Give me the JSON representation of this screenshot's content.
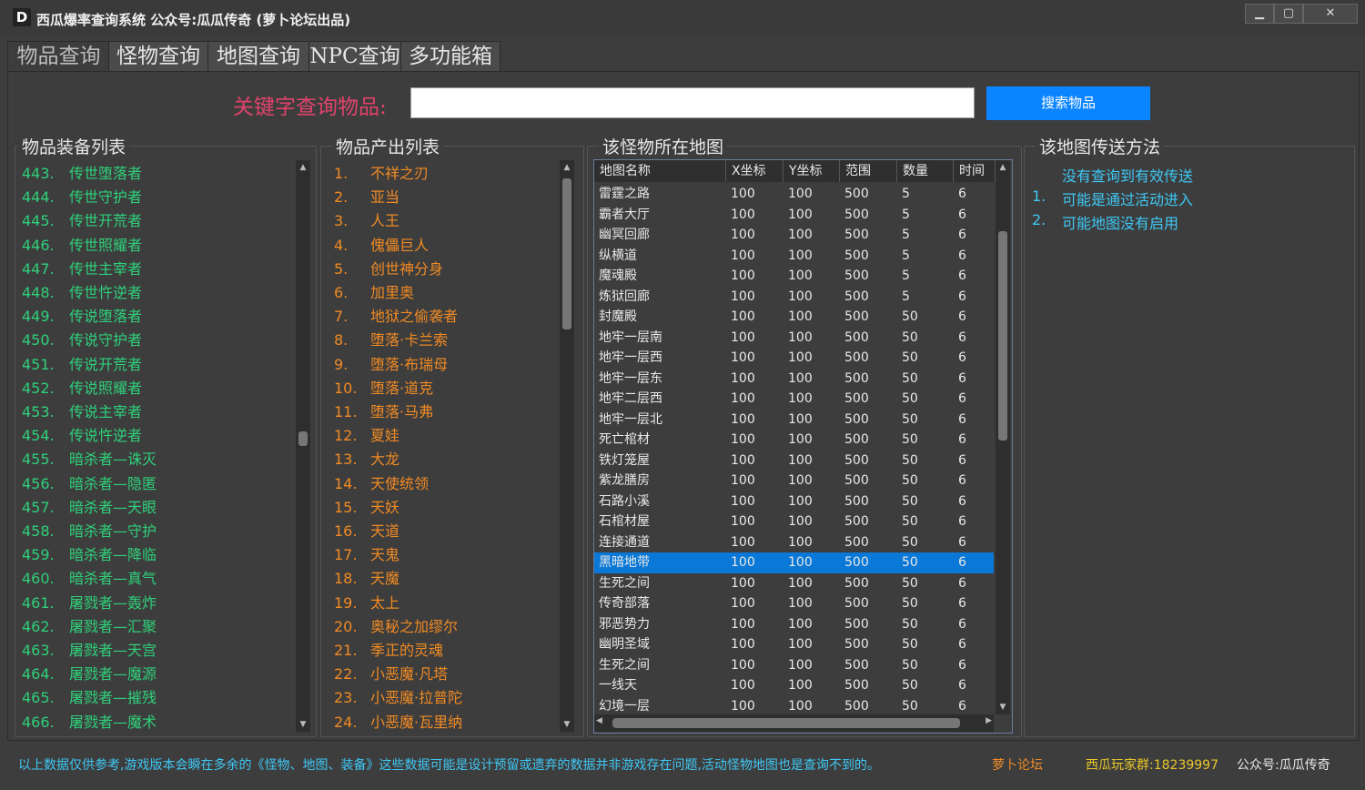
{
  "window": {
    "icon_letter": "D",
    "title": "西瓜爆率查询系统  公众号:瓜瓜传奇  (萝卜论坛出品)",
    "min_label": "▁",
    "max_label": "▢",
    "close_label": "✕"
  },
  "tabs": [
    {
      "label": "物品查询",
      "active": true
    },
    {
      "label": "怪物查询",
      "active": false
    },
    {
      "label": "地图查询",
      "active": false
    },
    {
      "label": "NPC查询",
      "active": false
    },
    {
      "label": "多功能箱",
      "active": false
    }
  ],
  "search": {
    "label": "关键字查询物品:",
    "value": "",
    "button_label": "搜索物品"
  },
  "items_panel": {
    "title": "物品装备列表",
    "color": "#2fd07a",
    "rows": [
      {
        "num": "443.",
        "name": "传世堕落者"
      },
      {
        "num": "444.",
        "name": "传世守护者"
      },
      {
        "num": "445.",
        "name": "传世开荒者"
      },
      {
        "num": "446.",
        "name": "传世照耀者"
      },
      {
        "num": "447.",
        "name": "传世主宰者"
      },
      {
        "num": "448.",
        "name": "传世忤逆者"
      },
      {
        "num": "449.",
        "name": "传说堕落者"
      },
      {
        "num": "450.",
        "name": "传说守护者"
      },
      {
        "num": "451.",
        "name": "传说开荒者"
      },
      {
        "num": "452.",
        "name": "传说照耀者"
      },
      {
        "num": "453.",
        "name": "传说主宰者"
      },
      {
        "num": "454.",
        "name": "传说忤逆者"
      },
      {
        "num": "455.",
        "name": "暗杀者—诛灭"
      },
      {
        "num": "456.",
        "name": "暗杀者—隐匿"
      },
      {
        "num": "457.",
        "name": "暗杀者—天眼"
      },
      {
        "num": "458.",
        "name": "暗杀者—守护"
      },
      {
        "num": "459.",
        "name": "暗杀者—降临"
      },
      {
        "num": "460.",
        "name": "暗杀者—真气"
      },
      {
        "num": "461.",
        "name": "屠戮者—轰炸"
      },
      {
        "num": "462.",
        "name": "屠戮者—汇聚"
      },
      {
        "num": "463.",
        "name": "屠戮者—天宫"
      },
      {
        "num": "464.",
        "name": "屠戮者—魔源"
      },
      {
        "num": "465.",
        "name": "屠戮者—摧残"
      },
      {
        "num": "466.",
        "name": "屠戮者—魔术"
      }
    ]
  },
  "drops_panel": {
    "title": "物品产出列表",
    "color": "#f08a24",
    "rows": [
      {
        "num": "1.",
        "name": "不祥之刃"
      },
      {
        "num": "2.",
        "name": "亚当"
      },
      {
        "num": "3.",
        "name": "人王"
      },
      {
        "num": "4.",
        "name": "傀儡巨人"
      },
      {
        "num": "5.",
        "name": "创世神分身"
      },
      {
        "num": "6.",
        "name": "加里奥"
      },
      {
        "num": "7.",
        "name": "地狱之偷袭者"
      },
      {
        "num": "8.",
        "name": "堕落·卡兰索"
      },
      {
        "num": "9.",
        "name": "堕落·布瑞母"
      },
      {
        "num": "10.",
        "name": "堕落·道克"
      },
      {
        "num": "11.",
        "name": "堕落·马弗"
      },
      {
        "num": "12.",
        "name": "夏娃"
      },
      {
        "num": "13.",
        "name": "大龙"
      },
      {
        "num": "14.",
        "name": "天使统领"
      },
      {
        "num": "15.",
        "name": "天妖"
      },
      {
        "num": "16.",
        "name": "天道"
      },
      {
        "num": "17.",
        "name": "天鬼"
      },
      {
        "num": "18.",
        "name": "天魔"
      },
      {
        "num": "19.",
        "name": "太上"
      },
      {
        "num": "20.",
        "name": "奥秘之加缪尔"
      },
      {
        "num": "21.",
        "name": "季正的灵魂"
      },
      {
        "num": "22.",
        "name": "小恶魔·凡塔"
      },
      {
        "num": "23.",
        "name": "小恶魔·拉普陀"
      },
      {
        "num": "24.",
        "name": "小恶魔·瓦里纳"
      }
    ]
  },
  "maps_panel": {
    "title": "该怪物所在地图",
    "columns": [
      "地图名称",
      "X坐标",
      "Y坐标",
      "范围",
      "数量",
      "时间"
    ],
    "selected_index": 18,
    "rows": [
      [
        "雷霆之路",
        "100",
        "100",
        "500",
        "5",
        "6"
      ],
      [
        "霸者大厅",
        "100",
        "100",
        "500",
        "5",
        "6"
      ],
      [
        "幽冥回廊",
        "100",
        "100",
        "500",
        "5",
        "6"
      ],
      [
        "纵横道",
        "100",
        "100",
        "500",
        "5",
        "6"
      ],
      [
        "魔魂殿",
        "100",
        "100",
        "500",
        "5",
        "6"
      ],
      [
        "炼狱回廊",
        "100",
        "100",
        "500",
        "5",
        "6"
      ],
      [
        "封魔殿",
        "100",
        "100",
        "500",
        "50",
        "6"
      ],
      [
        "地牢一层南",
        "100",
        "100",
        "500",
        "50",
        "6"
      ],
      [
        "地牢一层西",
        "100",
        "100",
        "500",
        "50",
        "6"
      ],
      [
        "地牢一层东",
        "100",
        "100",
        "500",
        "50",
        "6"
      ],
      [
        "地牢二层西",
        "100",
        "100",
        "500",
        "50",
        "6"
      ],
      [
        "地牢一层北",
        "100",
        "100",
        "500",
        "50",
        "6"
      ],
      [
        "死亡棺材",
        "100",
        "100",
        "500",
        "50",
        "6"
      ],
      [
        "铁灯笼屋",
        "100",
        "100",
        "500",
        "50",
        "6"
      ],
      [
        "紫龙膳房",
        "100",
        "100",
        "500",
        "50",
        "6"
      ],
      [
        "石路小溪",
        "100",
        "100",
        "500",
        "50",
        "6"
      ],
      [
        "石棺材屋",
        "100",
        "100",
        "500",
        "50",
        "6"
      ],
      [
        "连接通道",
        "100",
        "100",
        "500",
        "50",
        "6"
      ],
      [
        "黑暗地带",
        "100",
        "100",
        "500",
        "50",
        "6"
      ],
      [
        "生死之间",
        "100",
        "100",
        "500",
        "50",
        "6"
      ],
      [
        "传奇部落",
        "100",
        "100",
        "500",
        "50",
        "6"
      ],
      [
        "邪恶势力",
        "100",
        "100",
        "500",
        "50",
        "6"
      ],
      [
        "幽明圣域",
        "100",
        "100",
        "500",
        "50",
        "6"
      ],
      [
        "生死之间",
        "100",
        "100",
        "500",
        "50",
        "6"
      ],
      [
        "一线天",
        "100",
        "100",
        "500",
        "50",
        "6"
      ],
      [
        "幻境一层",
        "100",
        "100",
        "500",
        "50",
        "6"
      ]
    ]
  },
  "teleport_panel": {
    "title": "该地图传送方法",
    "color": "#3ec8f5",
    "lines": [
      {
        "num": "",
        "text": "没有查询到有效传送"
      },
      {
        "num": "1.",
        "text": "可能是通过活动进入"
      },
      {
        "num": "2.",
        "text": "可能地图没有启用"
      }
    ]
  },
  "status": {
    "notice": "以上数据仅供参考,游戏版本会瞬在多余的《怪物、地图、装备》这些数据可能是设计预留或遗弃的数据并非游戏存在问题,活动怪物地图也是查询不到的。",
    "notice_color": "#3ec8f5",
    "forum": "萝卜论坛",
    "forum_color": "#f08a24",
    "group": "西瓜玩家群:18239997",
    "group_color": "#e8c72a",
    "official": "公众号:瓜瓜传奇",
    "official_color": "#e8e8e8"
  }
}
